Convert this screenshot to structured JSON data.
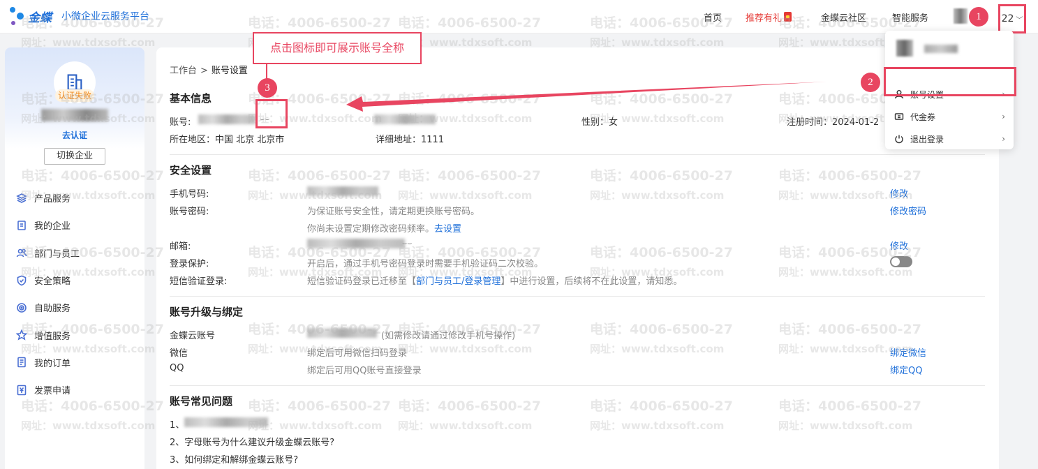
{
  "header": {
    "brand": "金蝶",
    "subtitle": "小微企业云服务平台",
    "nav": [
      "首页",
      "推荐有礼",
      "金蝶云社区",
      "智能服务"
    ],
    "user_suffix": "22",
    "chevron": "chevron-down-icon"
  },
  "sidebar": {
    "auth_status": "认证失败",
    "go_auth": "去认证",
    "switch_label": "切换企业",
    "items": [
      {
        "label": "产品服务",
        "icon": "layers-icon"
      },
      {
        "label": "我的企业",
        "icon": "document-icon"
      },
      {
        "label": "部门与员工",
        "icon": "users-icon"
      },
      {
        "label": "安全策略",
        "icon": "shield-icon"
      },
      {
        "label": "自助服务",
        "icon": "target-icon"
      },
      {
        "label": "增值服务",
        "icon": "star-icon"
      },
      {
        "label": "我的订单",
        "icon": "order-icon"
      },
      {
        "label": "发票申请",
        "icon": "invoice-icon"
      }
    ]
  },
  "breadcrumb": {
    "home": "工作台",
    "sep": ">",
    "current": "账号设置"
  },
  "basic": {
    "title": "基本信息",
    "account_label": "账号:",
    "gender": "性别：女",
    "register_time": "注册时间：2024-01-2",
    "region": "所在地区：中国 北京 北京市",
    "address": "详细地址：1111"
  },
  "security": {
    "title": "安全设置",
    "phone_label": "手机号码:",
    "phone_action": "修改",
    "password_label": "账号密码:",
    "password_desc": "为保证账号安全性，请定期更换账号密码。",
    "password_hint": "你尚未设置定期修改密码频率。",
    "password_hint_link": "去设置",
    "password_action": "修改密码",
    "email_label": "邮箱:",
    "email_action": "修改",
    "login_protect_label": "登录保护:",
    "login_protect_desc": "开启后，通过手机号密码登录时需要手机验证码二次校验。",
    "login_protect_on": false,
    "sms_label": "短信验证登录:",
    "sms_desc_pre": "短信验证码登录已迁移至【",
    "sms_desc_link": "部门与员工/登录管理",
    "sms_desc_post": "】中进行设置，后续将不在此设置，请知悉。"
  },
  "binding": {
    "title": "账号升级与绑定",
    "kingdee_label": "金蝶云账号",
    "kingdee_note": "(如需修改请通过修改手机号操作)",
    "wechat_label": "微信",
    "wechat_desc": "绑定后可用微信扫码登录",
    "wechat_action": "绑定微信",
    "qq_label": "QQ",
    "qq_desc": "绑定后可用QQ账号直接登录",
    "qq_action": "绑定QQ"
  },
  "faq": {
    "title": "账号常见问题",
    "q1_prefix": "1、",
    "q2": "2、字母账号为什么建议升级金蝶云账号?",
    "q3": "3、如何绑定和解绑金蝶云账号?"
  },
  "dropdown": {
    "items": [
      {
        "label": "账号设置",
        "icon": "user-icon"
      },
      {
        "label": "代金券",
        "icon": "voucher-icon"
      },
      {
        "label": "退出登录",
        "icon": "power-icon"
      }
    ],
    "arrow": "›"
  },
  "annotations": {
    "callout": "点击图标即可展示账号全称",
    "badge1": "1",
    "badge2": "2",
    "badge3": "3"
  },
  "watermark": {
    "phone": "电话：4006-6500-27",
    "site": "网址：www.tdxsoft.com"
  },
  "colors": {
    "primary": "#1e6fd9",
    "annotation": "#e84560",
    "warning": "#f08a1c"
  }
}
